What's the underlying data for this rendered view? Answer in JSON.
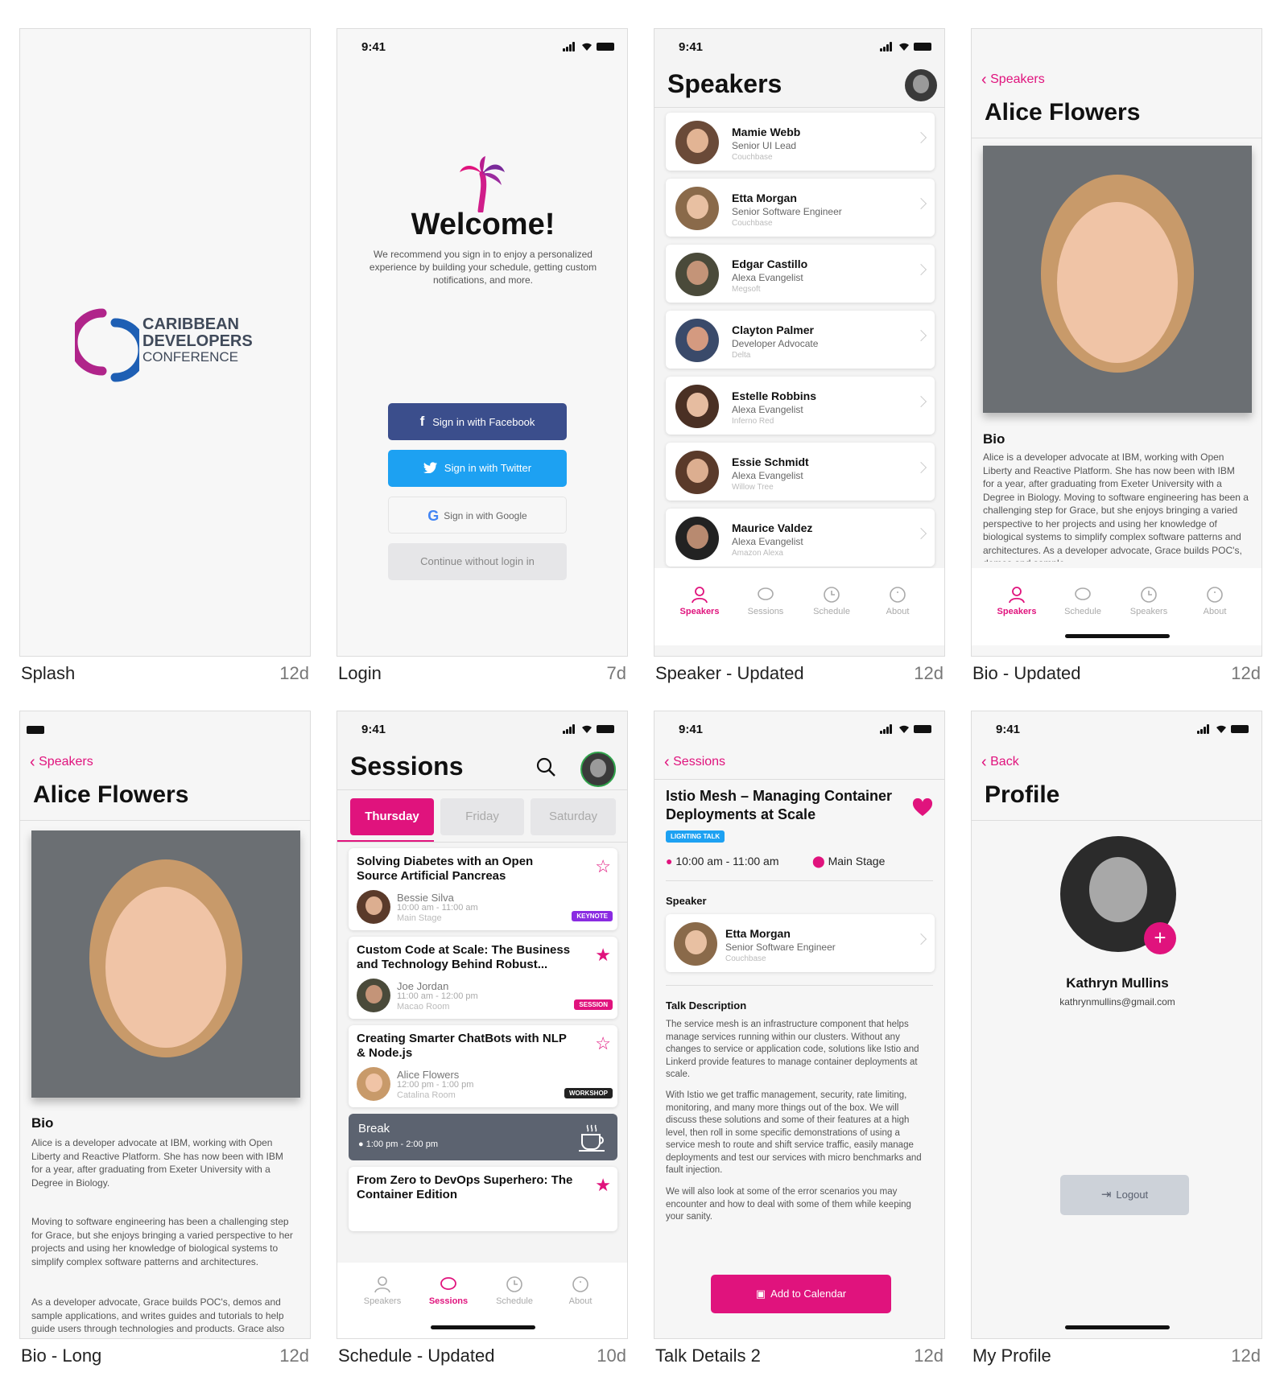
{
  "accent": "#e0137d",
  "status_time": "9:41",
  "cards": {
    "splash": {
      "name": "Splash",
      "age": "12d",
      "logo_line1": "CARIBBEAN",
      "logo_line2": "DEVELOPERS",
      "logo_line3": "CONFERENCE"
    },
    "login": {
      "name": "Login",
      "age": "7d",
      "title": "Welcome!",
      "subtitle": "We recommend you sign in to enjoy a personalized experience by building your schedule, getting custom notifications, and more.",
      "facebook": "Sign in with Facebook",
      "twitter": "Sign in with Twitter",
      "google": "Sign in with Google",
      "continue": "Continue without login in"
    },
    "speakers": {
      "name": "Speaker - Updated",
      "age": "12d",
      "title": "Speakers",
      "list": [
        {
          "name": "Mamie Webb",
          "role": "Senior UI Lead",
          "company": "Couchbase"
        },
        {
          "name": "Etta Morgan",
          "role": "Senior Software Engineer",
          "company": "Couchbase"
        },
        {
          "name": "Edgar Castillo",
          "role": "Alexa Evangelist",
          "company": "Megsoft"
        },
        {
          "name": "Clayton Palmer",
          "role": "Developer Advocate",
          "company": "Delta"
        },
        {
          "name": "Estelle Robbins",
          "role": "Alexa Evangelist",
          "company": "Inferno Red"
        },
        {
          "name": "Essie Schmidt",
          "role": "Alexa Evangelist",
          "company": "Willow Tree"
        },
        {
          "name": "Maurice Valdez",
          "role": "Alexa Evangelist",
          "company": "Amazon Alexa"
        }
      ],
      "tabs": [
        "Speakers",
        "Sessions",
        "Schedule",
        "About"
      ]
    },
    "bio": {
      "name": "Bio - Updated",
      "age": "12d",
      "back": "Speakers",
      "title": "Alice Flowers",
      "bio_heading": "Bio",
      "bio_text": "Alice is a developer advocate at IBM, working with Open Liberty and Reactive Platform. She has now been with IBM for a year, after graduating from Exeter University with a Degree in Biology. Moving to software engineering has been a challenging step for Grace, but she enjoys bringing a varied perspective to her projects and using her knowledge of biological systems to simplify complex software patterns and architectures. As a developer advocate, Grace builds POC's, demos and sample",
      "tabs": [
        "Speakers",
        "Schedule",
        "Speakers",
        "About"
      ]
    },
    "bio_long": {
      "name": "Bio - Long",
      "age": "12d",
      "back": "Speakers",
      "title": "Alice Flowers",
      "bio_heading": "Bio",
      "para1": "Alice is a developer advocate at IBM, working with Open Liberty and Reactive Platform. She has now been with IBM for a year, after graduating from Exeter University with a Degree in Biology.",
      "para2": "Moving to software engineering has been a challenging step for Grace, but she enjoys bringing a varied perspective to her projects and using her knowledge of biological systems to simplify complex software patterns and architectures.",
      "para3": "As a developer advocate, Grace builds POC's, demos and sample applications, and writes guides and tutorials to help guide users through technologies and products. Grace also has a keen passion for encouraging more women into"
    },
    "sessions": {
      "name": "Schedule - Updated",
      "age": "10d",
      "title": "Sessions",
      "days": [
        "Thursday",
        "Friday",
        "Saturday"
      ],
      "items": [
        {
          "title": "Solving Diabetes with an Open Source Artificial Pancreas",
          "speaker": "Bessie Silva",
          "time": "10:00 am - 11:00 am",
          "room": "Main Stage",
          "badge": "KEYNOTE"
        },
        {
          "title": "Custom Code at Scale: The Business and Technology Behind Robust...",
          "speaker": "Joe Jordan",
          "time": "11:00 am - 12:00 pm",
          "room": "Macao Room",
          "badge": "SESSION"
        },
        {
          "title": "Creating Smarter ChatBots with NLP & Node.js",
          "speaker": "Alice Flowers",
          "time": "12:00 pm - 1:00 pm",
          "room": "Catalina Room",
          "badge": "WORKSHOP"
        }
      ],
      "break_title": "Break",
      "break_time": "1:00 pm - 2:00 pm",
      "last_title": "From Zero to DevOps Superhero: The Container Edition",
      "tabs": [
        "Speakers",
        "Sessions",
        "Schedule",
        "About"
      ]
    },
    "talk": {
      "name": "Talk Details 2",
      "age": "12d",
      "back": "Sessions",
      "title": "Istio Mesh – Managing Container Deployments at Scale",
      "tag": "LIGNTING TALK",
      "time": "10:00 am - 11:00 am",
      "location": "Main Stage",
      "speaker_heading": "Speaker",
      "speaker": {
        "name": "Etta Morgan",
        "role": "Senior Software Engineer",
        "company": "Couchbase"
      },
      "desc_heading": "Talk Description",
      "desc1": "The service mesh is an infrastructure component that helps manage services running within our clusters. Without any changes to service or application code, solutions like Istio and Linkerd provide features to manage container deployments at scale.",
      "desc2": "With Istio we get traffic management, security, rate limiting, monitoring, and many more things out of the box. We will discuss these solutions and some of their features at a high level, then roll in some specific demonstrations of using a service mesh to route and shift service traffic, easily manage deployments and test our services with micro benchmarks and fault injection.",
      "desc3": "We will also look at some of the error scenarios you may encounter and how to deal with some of them while keeping your sanity.",
      "add_calendar": "Add to Calendar"
    },
    "profile": {
      "name": "My Profile",
      "age": "12d",
      "back": "Back",
      "title": "Profile",
      "user": "Kathryn Mullins",
      "email": "kathrynmullins@gmail.com",
      "logout": "Logout"
    }
  }
}
